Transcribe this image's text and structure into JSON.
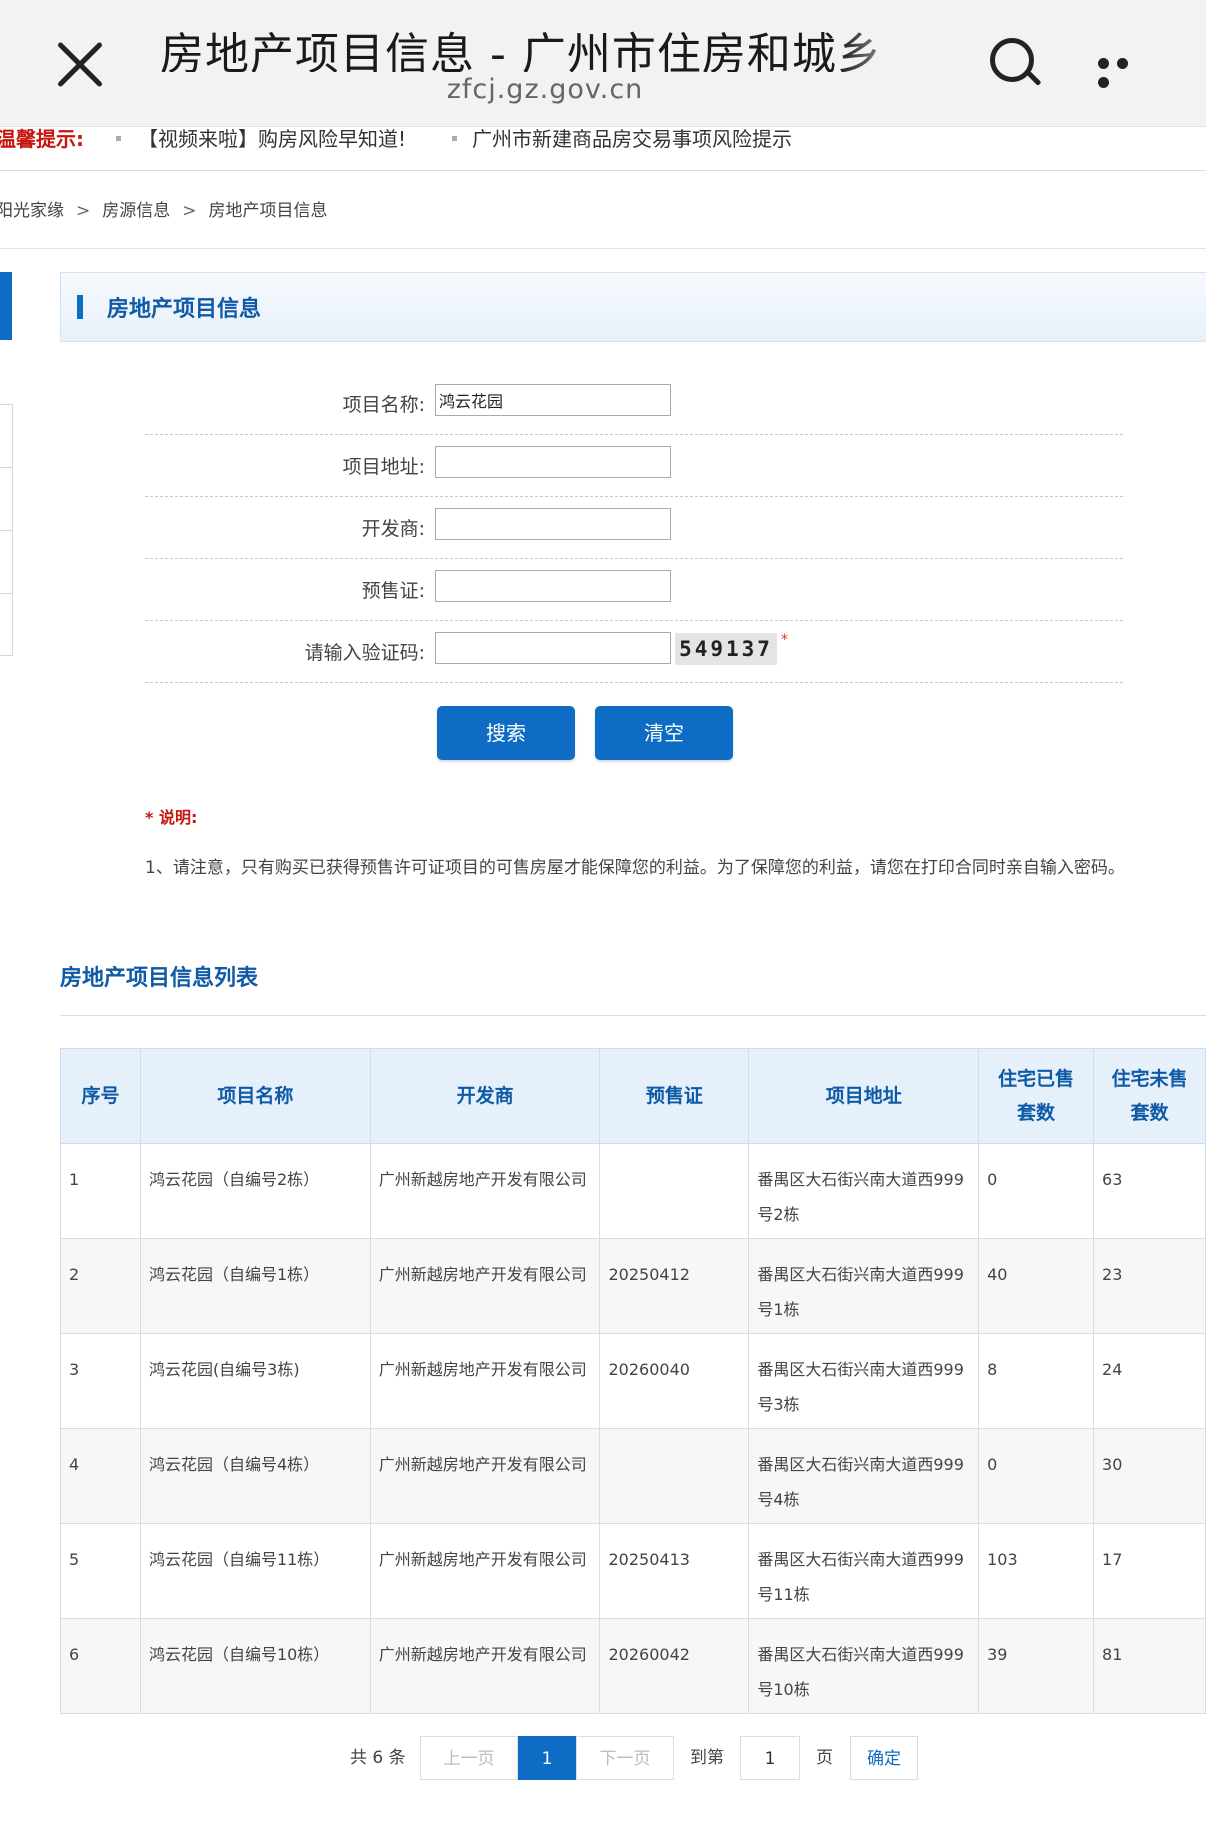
{
  "browser": {
    "title": "房地产项目信息 - 广州市住房和城乡",
    "domain": "zfcj.gz.gov.cn"
  },
  "notice": {
    "label": "温馨提示:",
    "items": [
      "【视频来啦】购房风险早知道!",
      "广州市新建商品房交易事项风险提示"
    ]
  },
  "breadcrumb": [
    "阳光家缘",
    "房源信息",
    "房地产项目信息"
  ],
  "breadcrumb_sep": ">",
  "panel": {
    "title": "房地产项目信息"
  },
  "form": {
    "name_label": "项目名称:",
    "name_value": "鸿云花园",
    "address_label": "项目地址:",
    "address_value": "",
    "developer_label": "开发商:",
    "developer_value": "",
    "presale_label": "预售证:",
    "presale_value": "",
    "captcha_label": "请输入验证码:",
    "captcha_value": "",
    "captcha_code": "549137",
    "required_mark": "*"
  },
  "buttons": {
    "search": "搜索",
    "clear": "清空"
  },
  "note": {
    "title": "* 说明:",
    "text": "1、请注意，只有购买已获得预售许可证项目的可售房屋才能保障您的利益。为了保障您的利益，请您在打印合同时亲自输入密码。"
  },
  "list": {
    "title": "房地产项目信息列表",
    "headers": [
      "序号",
      "项目名称",
      "开发商",
      "预售证",
      "项目地址",
      "住宅已售套数",
      "住宅未售套数"
    ],
    "rows": [
      [
        "1",
        "鸿云花园（自编号2栋）",
        "广州新越房地产开发有限公司",
        "",
        "番禺区大石街兴南大道西999号2栋",
        "0",
        "63"
      ],
      [
        "2",
        "鸿云花园（自编号1栋）",
        "广州新越房地产开发有限公司",
        "20250412",
        "番禺区大石街兴南大道西999号1栋",
        "40",
        "23"
      ],
      [
        "3",
        "鸿云花园(自编号3栋)",
        "广州新越房地产开发有限公司",
        "20260040",
        "番禺区大石街兴南大道西999号3栋",
        "8",
        "24"
      ],
      [
        "4",
        "鸿云花园（自编号4栋）",
        "广州新越房地产开发有限公司",
        "",
        "番禺区大石街兴南大道西999号4栋",
        "0",
        "30"
      ],
      [
        "5",
        "鸿云花园（自编号11栋）",
        "广州新越房地产开发有限公司",
        "20250413",
        "番禺区大石街兴南大道西999号11栋",
        "103",
        "17"
      ],
      [
        "6",
        "鸿云花园（自编号10栋）",
        "广州新越房地产开发有限公司",
        "20260042",
        "番禺区大石街兴南大道西999号10栋",
        "39",
        "81"
      ]
    ]
  },
  "pagination": {
    "total": "共 6 条",
    "prev": "上一页",
    "current": "1",
    "next": "下一页",
    "goto_label": "到第",
    "goto_value": "1",
    "page_unit": "页",
    "confirm": "确定"
  }
}
